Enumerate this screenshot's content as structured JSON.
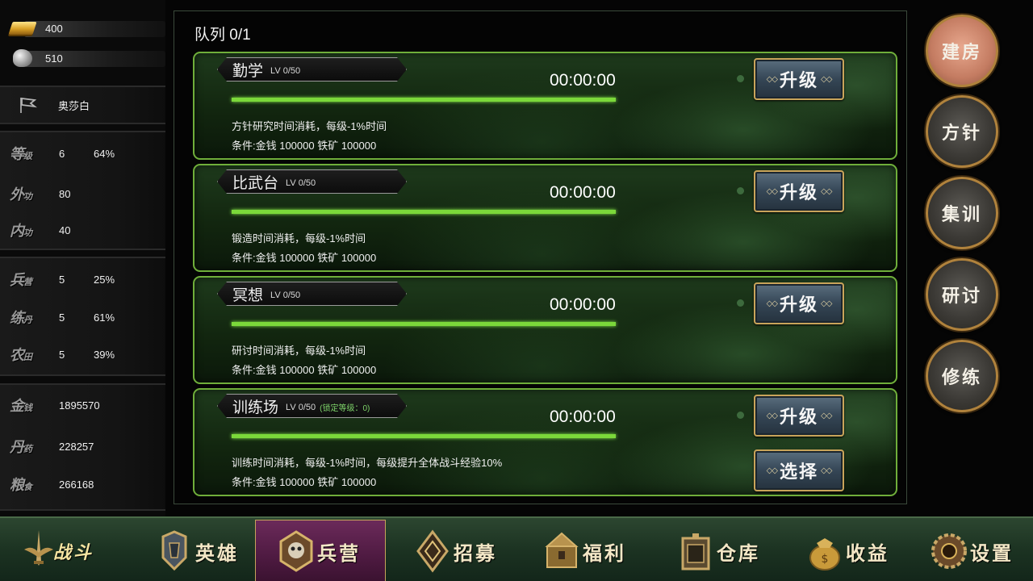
{
  "resources": [
    {
      "icon": "gold-ingot-icon",
      "value": "400"
    },
    {
      "icon": "silver-ore-icon",
      "value": "510"
    }
  ],
  "player": {
    "icon": "flag-icon",
    "name": "奥莎白"
  },
  "stats_group1": [
    {
      "label": "等",
      "sub": "级",
      "v1": "6",
      "v2": "64%"
    },
    {
      "label": "外",
      "sub": "功",
      "v1": "80",
      "v2": ""
    },
    {
      "label": "内",
      "sub": "功",
      "v1": "40",
      "v2": ""
    }
  ],
  "stats_group2": [
    {
      "label": "兵",
      "sub": "营",
      "v1": "5",
      "v2": "25%"
    },
    {
      "label": "练",
      "sub": "丹",
      "v1": "5",
      "v2": "61%"
    },
    {
      "label": "农",
      "sub": "田",
      "v1": "5",
      "v2": "39%"
    }
  ],
  "stats_group3": [
    {
      "label": "金",
      "sub": "钱",
      "v1": "1895570"
    },
    {
      "label": "丹",
      "sub": "药",
      "v1": "228257"
    },
    {
      "label": "粮",
      "sub": "食",
      "v1": "266168"
    }
  ],
  "queue_title": "队列 0/1",
  "upgrade_label": "升级",
  "select_label": "选择",
  "buildings": [
    {
      "name": "勤学",
      "level": "LV 0/50",
      "lock": "",
      "timer": "00:00:00",
      "progress": 1.0,
      "desc": "方针研究时间消耗，每级-1%时间",
      "cond": "条件:金钱 100000 铁矿 100000"
    },
    {
      "name": "比武台",
      "level": "LV 0/50",
      "lock": "",
      "timer": "00:00:00",
      "progress": 1.0,
      "desc": "锻造时间消耗，每级-1%时间",
      "cond": "条件:金钱 100000 铁矿 100000"
    },
    {
      "name": "冥想",
      "level": "LV 0/50",
      "lock": "",
      "timer": "00:00:00",
      "progress": 1.0,
      "desc": "研讨时间消耗，每级-1%时间",
      "cond": "条件:金钱 100000 铁矿 100000"
    },
    {
      "name": "训练场",
      "level": "LV 0/50",
      "lock": "(锁定等级：0)",
      "timer": "00:00:00",
      "progress": 1.0,
      "desc": "训练时间消耗，每级-1%时间，每级提升全体战斗经验10%",
      "cond": "条件:金钱 100000 铁矿 100000"
    }
  ],
  "side_buttons": [
    "建房",
    "方针",
    "集训",
    "研讨",
    "修练"
  ],
  "side_active": 0,
  "nav": [
    {
      "label": "战斗",
      "icon": "sword-wings-icon"
    },
    {
      "label": "英雄",
      "icon": "helmet-icon"
    },
    {
      "label": "兵营",
      "icon": "skull-shield-icon"
    },
    {
      "label": "招募",
      "icon": "diamond-frame-icon"
    },
    {
      "label": "福利",
      "icon": "treasure-chest-icon"
    },
    {
      "label": "仓库",
      "icon": "storage-chest-icon"
    },
    {
      "label": "收益",
      "icon": "money-bag-icon"
    },
    {
      "label": "设置",
      "icon": "gear-icon"
    }
  ],
  "nav_active": 2,
  "colors": {
    "progress": "#7bd83a",
    "card_border": "#6fae3a",
    "nav_active": "#4e1a41",
    "button_border": "#c8a45a"
  }
}
